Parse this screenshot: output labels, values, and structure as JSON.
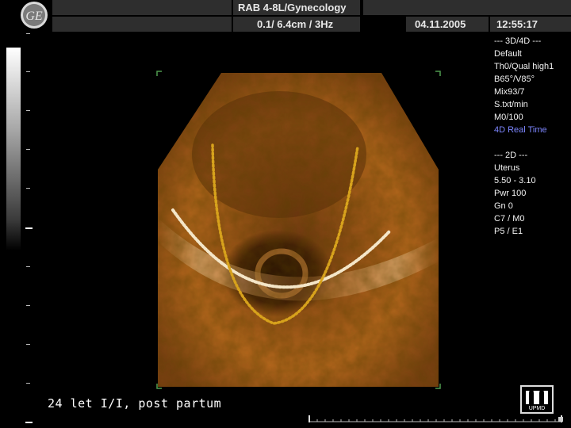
{
  "header": {
    "probe": "RAB 4-8L/Gynecology",
    "depth_freq": "0.1/ 6.4cm / 3Hz",
    "date": "04.11.2005",
    "time": "12:55:17"
  },
  "params_3d": [
    "--- 3D/4D ---",
    "Default",
    "Th0/Qual high1",
    "B65°/V85°",
    "Mix93/7",
    "S.txt/min",
    "M0/100"
  ],
  "params_3d_mode": "4D Real Time",
  "params_2d": [
    "--- 2D ---",
    "Uterus",
    "5.50 - 3.10",
    "Pwr 100",
    "Gn  0",
    "C7 / M0",
    "P5 / E1"
  ],
  "caption": "24 let I/I, post partum",
  "watermark_text": "UPMD",
  "colors": {
    "highlight": "#7d86ff",
    "header_box": "#2e2e2e",
    "render_tone": "#b8681e",
    "curve_yellow": "#d7a21c",
    "curve_white": "#f4e6c8",
    "roi_corner": "#4f9a4f"
  },
  "icons": {
    "logo": "ge-logo-icon",
    "watermark": "upmd-logo-icon"
  }
}
